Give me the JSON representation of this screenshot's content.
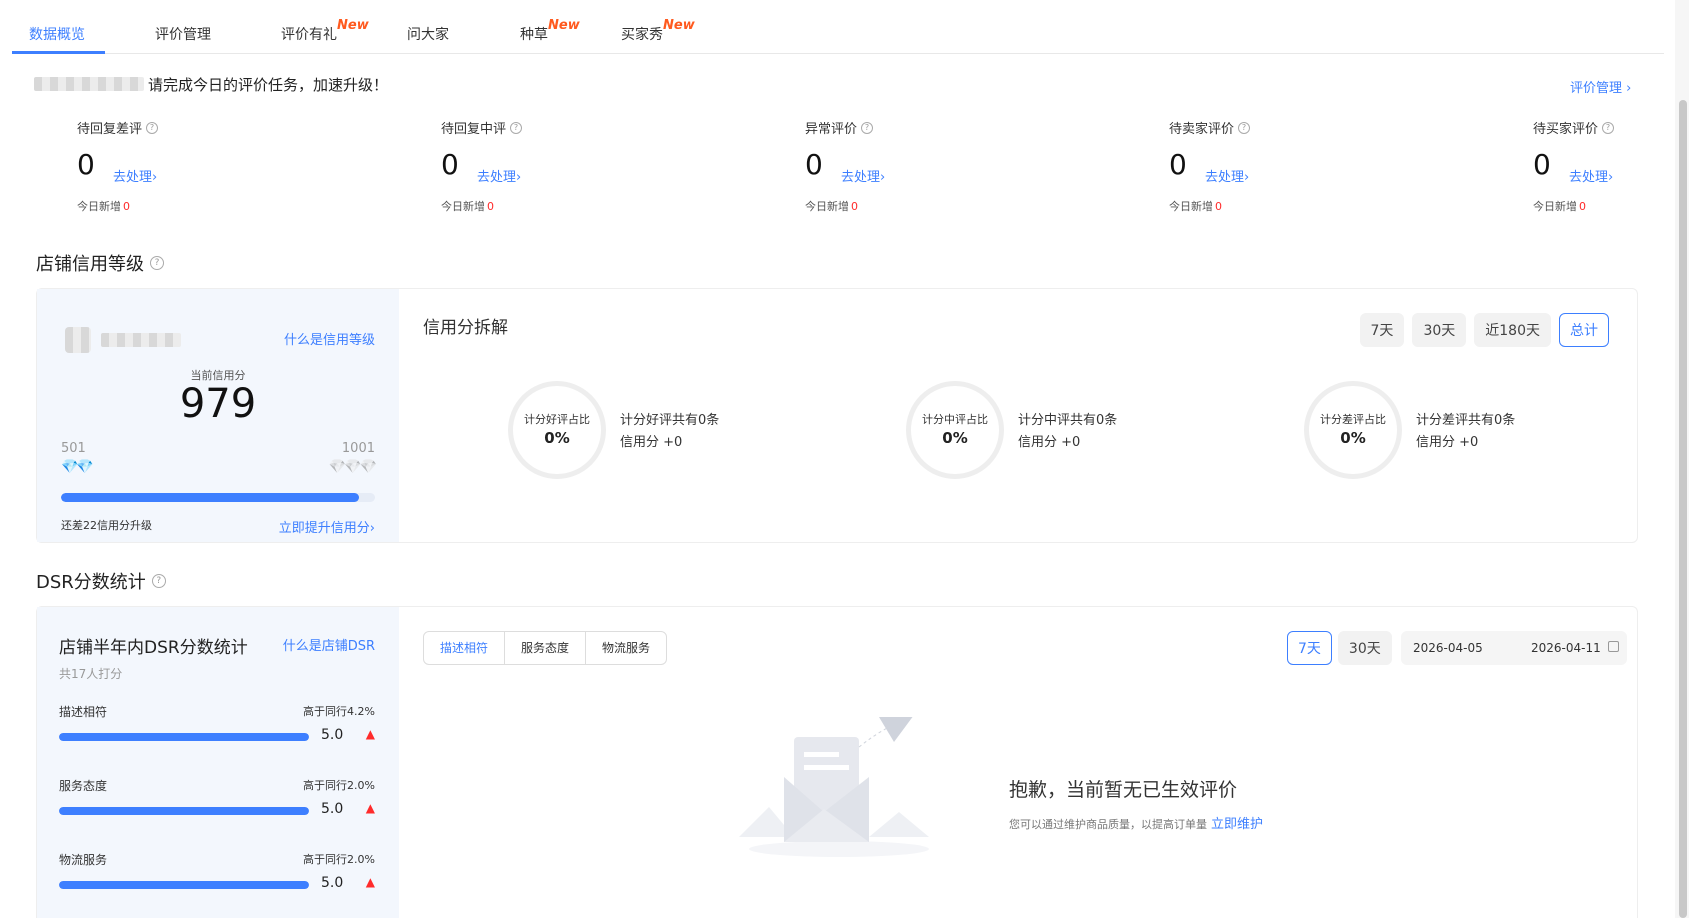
{
  "tabs": [
    {
      "label": "数据概览",
      "active": true,
      "new": ""
    },
    {
      "label": "评价管理",
      "active": false,
      "new": ""
    },
    {
      "label": "评价有礼",
      "active": false,
      "new": "New"
    },
    {
      "label": "问大家",
      "active": false,
      "new": ""
    },
    {
      "label": "种草",
      "active": false,
      "new": "New"
    },
    {
      "label": "买家秀",
      "active": false,
      "new": "New"
    }
  ],
  "greeting": "请完成今日的评价任务，加速升级！",
  "top_link": "评价管理 ›",
  "stats": [
    {
      "label": "待回复差评",
      "value": "0",
      "action": "去处理›",
      "sub": "今日新增",
      "sub_value": "0"
    },
    {
      "label": "待回复中评",
      "value": "0",
      "action": "去处理›",
      "sub": "今日新增",
      "sub_value": "0"
    },
    {
      "label": "异常评价",
      "value": "0",
      "action": "去处理›",
      "sub": "今日新增",
      "sub_value": "0"
    },
    {
      "label": "待卖家评价",
      "value": "0",
      "action": "去处理›",
      "sub": "今日新增",
      "sub_value": "0"
    },
    {
      "label": "待买家评价",
      "value": "0",
      "action": "去处理›",
      "sub": "今日新增",
      "sub_value": "0"
    }
  ],
  "credit": {
    "section_title": "店铺信用等级",
    "what_link": "什么是信用等级",
    "caption": "当前信用分",
    "score": "979",
    "range_low": "501",
    "range_high": "1001",
    "progress_fraction": 0.95,
    "hint": "还差22信用分升级",
    "upgrade_link": "立即提升信用分›"
  },
  "breakdown": {
    "title": "信用分拆解",
    "periods": [
      "7天",
      "30天",
      "近180天",
      "总计"
    ],
    "active_period": "总计",
    "rings": [
      {
        "label": "计分好评占比",
        "pct": "0%",
        "line1": "计分好评共有0条",
        "line2": "信用分 +0"
      },
      {
        "label": "计分中评占比",
        "pct": "0%",
        "line1": "计分中评共有0条",
        "line2": "信用分 +0"
      },
      {
        "label": "计分差评占比",
        "pct": "0%",
        "line1": "计分差评共有0条",
        "line2": "信用分 +0"
      }
    ]
  },
  "dsr": {
    "section_title": "DSR分数统计",
    "card_title": "店铺半年内DSR分数统计",
    "what_link": "什么是店铺DSR",
    "count": "共17人打分",
    "rows": [
      {
        "name": "描述相符",
        "higher": "高于同行4.2%",
        "value": "5.0",
        "fraction": 1.0
      },
      {
        "name": "服务态度",
        "higher": "高于同行2.0%",
        "value": "5.0",
        "fraction": 1.0
      },
      {
        "name": "物流服务",
        "higher": "高于同行2.0%",
        "value": "5.0",
        "fraction": 1.0
      }
    ],
    "tabs": [
      "描述相符",
      "服务态度",
      "物流服务"
    ],
    "periods": [
      "7天",
      "30天"
    ],
    "date_start": "2026-04-05",
    "date_end": "2026-04-11",
    "empty_title": "抱歉，当前暂无已生效评价",
    "empty_desc": "您可以通过维护商品质量，以提高订单量",
    "empty_link": "立即维护"
  },
  "colors": {
    "accent": "#3d7fff",
    "new_badge": "#ff5a1f",
    "alert": "#ff2b2b",
    "left_panel_bg": "#f3f7fd"
  }
}
